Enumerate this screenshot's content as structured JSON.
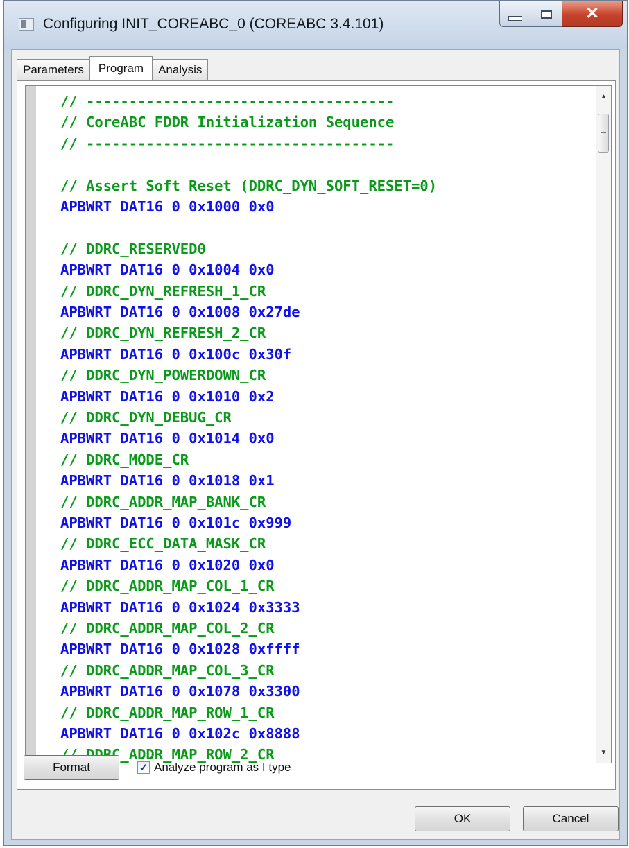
{
  "window": {
    "title": "Configuring INIT_COREABC_0 (COREABC 3.4.101)"
  },
  "tabs": [
    {
      "label": "Parameters",
      "active": false
    },
    {
      "label": "Program",
      "active": true
    },
    {
      "label": "Analysis",
      "active": false
    }
  ],
  "editor": {
    "lines": [
      {
        "text": "// ------------------------------------",
        "kind": "comment"
      },
      {
        "text": "// CoreABC FDDR Initialization Sequence",
        "kind": "comment"
      },
      {
        "text": "// ------------------------------------",
        "kind": "comment"
      },
      {
        "text": "",
        "kind": "comment"
      },
      {
        "text": "// Assert Soft Reset (DDRC_DYN_SOFT_RESET=0)",
        "kind": "comment"
      },
      {
        "text": "APBWRT DAT16 0 0x1000 0x0",
        "kind": "instr"
      },
      {
        "text": "",
        "kind": "comment"
      },
      {
        "text": "// DDRC_RESERVED0",
        "kind": "comment"
      },
      {
        "text": "APBWRT DAT16 0 0x1004 0x0",
        "kind": "instr"
      },
      {
        "text": "// DDRC_DYN_REFRESH_1_CR",
        "kind": "comment"
      },
      {
        "text": "APBWRT DAT16 0 0x1008 0x27de",
        "kind": "instr"
      },
      {
        "text": "// DDRC_DYN_REFRESH_2_CR",
        "kind": "comment"
      },
      {
        "text": "APBWRT DAT16 0 0x100c 0x30f",
        "kind": "instr"
      },
      {
        "text": "// DDRC_DYN_POWERDOWN_CR",
        "kind": "comment"
      },
      {
        "text": "APBWRT DAT16 0 0x1010 0x2",
        "kind": "instr"
      },
      {
        "text": "// DDRC_DYN_DEBUG_CR",
        "kind": "comment"
      },
      {
        "text": "APBWRT DAT16 0 0x1014 0x0",
        "kind": "instr"
      },
      {
        "text": "// DDRC_MODE_CR",
        "kind": "comment"
      },
      {
        "text": "APBWRT DAT16 0 0x1018 0x1",
        "kind": "instr"
      },
      {
        "text": "// DDRC_ADDR_MAP_BANK_CR",
        "kind": "comment"
      },
      {
        "text": "APBWRT DAT16 0 0x101c 0x999",
        "kind": "instr"
      },
      {
        "text": "// DDRC_ECC_DATA_MASK_CR",
        "kind": "comment"
      },
      {
        "text": "APBWRT DAT16 0 0x1020 0x0",
        "kind": "instr"
      },
      {
        "text": "// DDRC_ADDR_MAP_COL_1_CR",
        "kind": "comment"
      },
      {
        "text": "APBWRT DAT16 0 0x1024 0x3333",
        "kind": "instr"
      },
      {
        "text": "// DDRC_ADDR_MAP_COL_2_CR",
        "kind": "comment"
      },
      {
        "text": "APBWRT DAT16 0 0x1028 0xffff",
        "kind": "instr"
      },
      {
        "text": "// DDRC_ADDR_MAP_COL_3_CR",
        "kind": "comment"
      },
      {
        "text": "APBWRT DAT16 0 0x1078 0x3300",
        "kind": "instr"
      },
      {
        "text": "// DDRC_ADDR_MAP_ROW_1_CR",
        "kind": "comment"
      },
      {
        "text": "APBWRT DAT16 0 0x102c 0x8888",
        "kind": "instr"
      },
      {
        "text": "// DDRC_ADDR_MAP_ROW_2_CR",
        "kind": "comment"
      }
    ],
    "comment_color": "#0a9a19",
    "instruction_color": "#1010e8"
  },
  "bottom": {
    "format_label": "Format",
    "analyze_label": "Analyze program as I type",
    "analyze_checked": true,
    "ok_label": "OK",
    "cancel_label": "Cancel"
  }
}
